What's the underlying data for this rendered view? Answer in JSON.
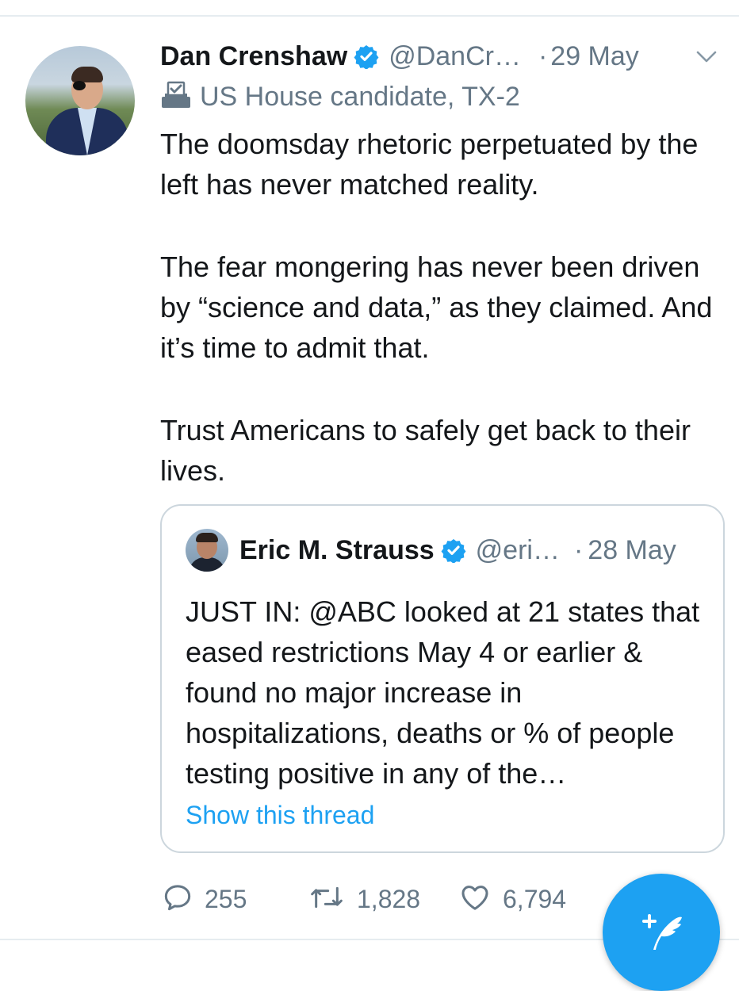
{
  "tweet": {
    "author_name": "Dan Crenshaw",
    "author_handle": "@DanCr…",
    "separator": "·",
    "date": "29 May",
    "candidate_label": "US House candidate, TX-2",
    "paragraphs": [
      "The doomsday rhetoric perpetuated by the left has never matched reality.",
      "The fear mongering has never been driven by “science and data,” as they claimed. And it’s time to admit that.",
      "Trust Americans to safely get back to their lives."
    ]
  },
  "quoted_tweet": {
    "author_name": "Eric M. Strauss",
    "author_handle": "@eri…",
    "separator": "·",
    "date": "28 May",
    "text": "JUST IN: @ABC looked at 21 states that eased restrictions May 4 or earlier & found no major increase in hospitalizations, deaths or % of people testing positive in any of the…",
    "show_thread": "Show this thread"
  },
  "actions": {
    "replies": "255",
    "retweets": "1,828",
    "likes": "6,794"
  },
  "icons": {
    "verified": "verified-badge-icon",
    "chevron": "chevron-down-icon",
    "ballot": "ballot-box-icon",
    "reply": "reply-icon",
    "retweet": "retweet-icon",
    "like": "heart-icon",
    "compose": "compose-tweet-icon"
  },
  "colors": {
    "accent": "#1da1f2",
    "text": "#14171a",
    "secondary": "#657786",
    "border": "#ccd6dd"
  }
}
